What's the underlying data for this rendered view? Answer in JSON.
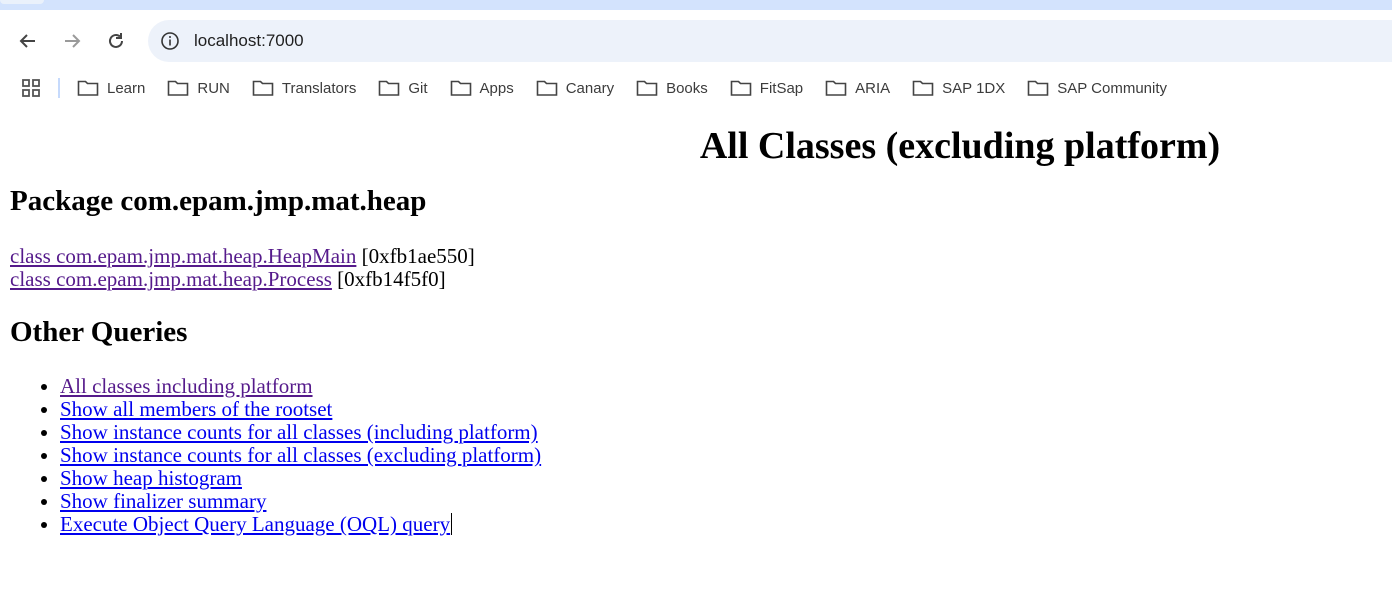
{
  "browser": {
    "url": "localhost:7000",
    "bookmarks": [
      "Learn",
      "RUN",
      "Translators",
      "Git",
      "Apps",
      "Canary",
      "Books",
      "FitSap",
      "ARIA",
      "SAP 1DX",
      "SAP Community"
    ]
  },
  "page": {
    "title": "All Classes (excluding platform)",
    "package_heading": "Package com.epam.jmp.mat.heap",
    "classes": [
      {
        "name": "class com.epam.jmp.mat.heap.HeapMain",
        "address": "[0xfb1ae550]"
      },
      {
        "name": "class com.epam.jmp.mat.heap.Process",
        "address": "[0xfb14f5f0]"
      }
    ],
    "other_heading": "Other Queries",
    "queries": [
      "All classes including platform",
      "Show all members of the rootset",
      "Show instance counts for all classes (including platform)",
      "Show instance counts for all classes (excluding platform)",
      "Show heap histogram",
      "Show finalizer summary",
      "Execute Object Query Language (OQL) query"
    ]
  },
  "colors": {
    "link": "#0000ee",
    "visited_link": "#551a8b",
    "tabstrip": "#d3e3fd",
    "omnibox": "#edf2fa"
  }
}
